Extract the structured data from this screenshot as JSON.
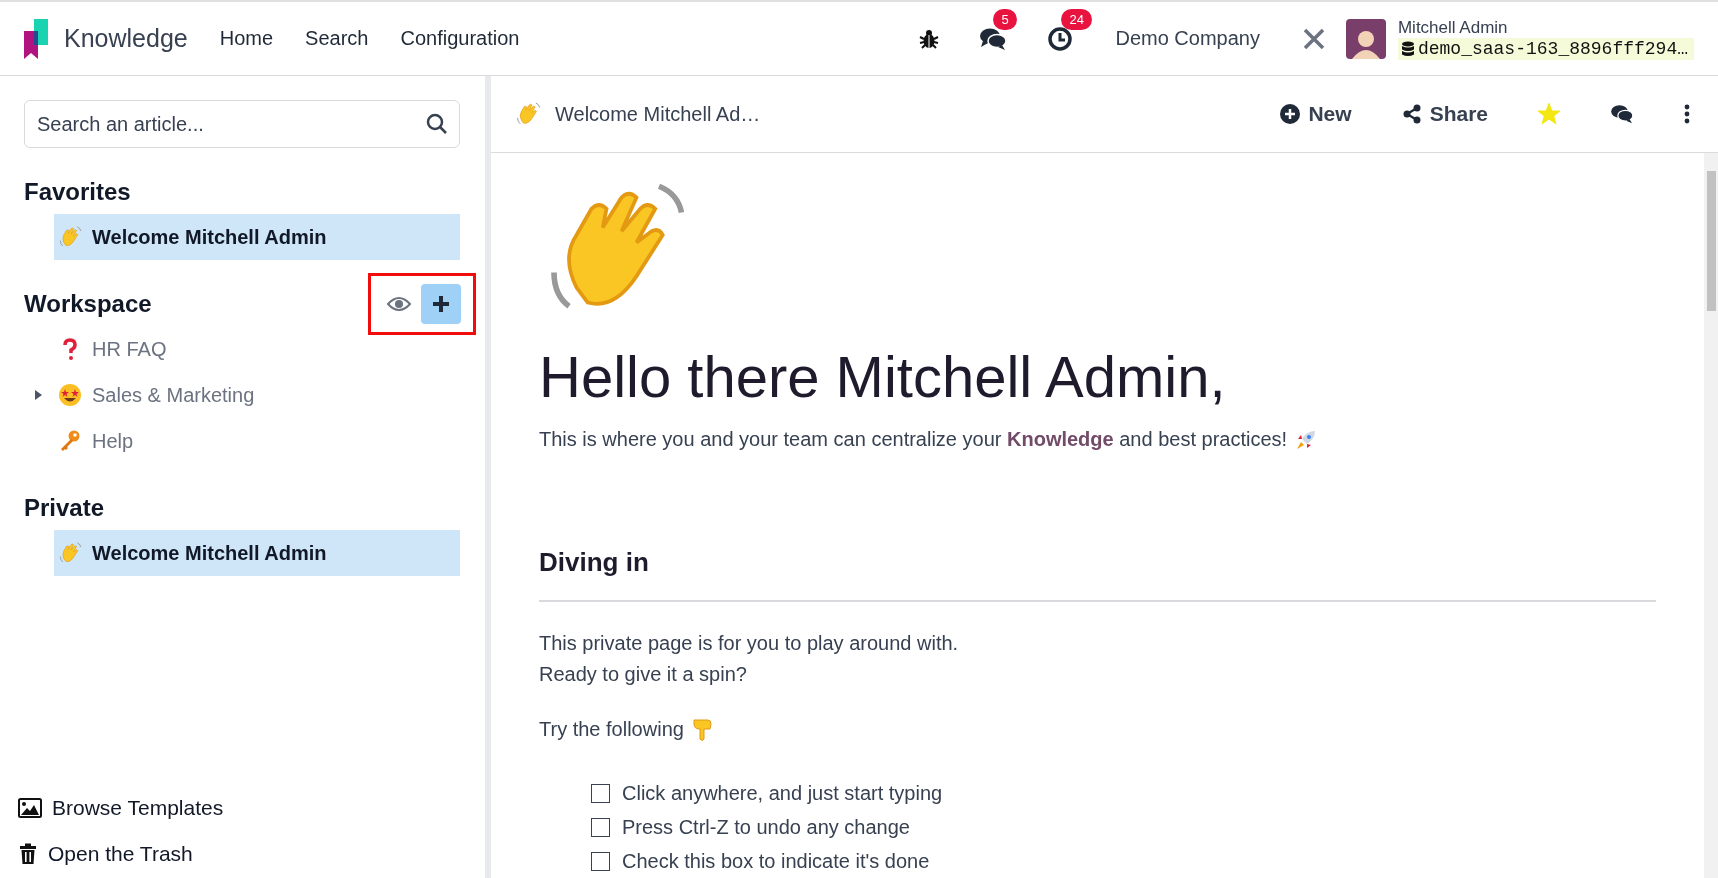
{
  "navbar": {
    "app_name": "Knowledge",
    "menu": [
      "Home",
      "Search",
      "Configuration"
    ],
    "messages_count": "5",
    "activities_count": "24",
    "company": "Demo Company",
    "user": {
      "name": "Mitchell Admin",
      "database": "demo_saas-163_8896fff294…"
    }
  },
  "sidebar": {
    "search": {
      "placeholder": "Search an article..."
    },
    "sections": [
      {
        "title": "Favorites",
        "items": [
          {
            "kind": "wave",
            "label": "Welcome Mitchell Admin",
            "selected": true
          }
        ]
      },
      {
        "title": "Workspace",
        "actions": {
          "highlighted": true
        },
        "items": [
          {
            "kind": "question",
            "label": "HR FAQ",
            "selected": false
          },
          {
            "kind": "starstruck",
            "label": "Sales & Marketing",
            "selected": false,
            "expanded": false
          },
          {
            "kind": "key",
            "label": "Help",
            "selected": false
          }
        ]
      },
      {
        "title": "Private",
        "items": [
          {
            "kind": "wave",
            "label": "Welcome Mitchell Admin",
            "selected": true
          }
        ]
      }
    ],
    "footer": [
      {
        "kind": "templates",
        "label": "Browse Templates"
      },
      {
        "kind": "trash",
        "label": "Open the Trash"
      }
    ]
  },
  "header": {
    "breadcrumb": "Welcome Mitchell Ad…",
    "new_label": "New",
    "share_label": "Share",
    "favorite": true
  },
  "article": {
    "title": "Hello there Mitchell Admin,",
    "intro": "This is where you and your team can centralize your **Knowledge** and best practices!",
    "section_title": "Diving in",
    "lines": [
      "This private page is for you to play around with.",
      "Ready to give it a spin?"
    ],
    "try_label": "Try the following",
    "checklist": [
      {
        "label": "Click anywhere, and just start typing",
        "checked": false
      },
      {
        "label": "Press Ctrl-Z to undo any change",
        "checked": false
      },
      {
        "label": "Check this box to indicate it's done",
        "checked": false
      }
    ]
  }
}
